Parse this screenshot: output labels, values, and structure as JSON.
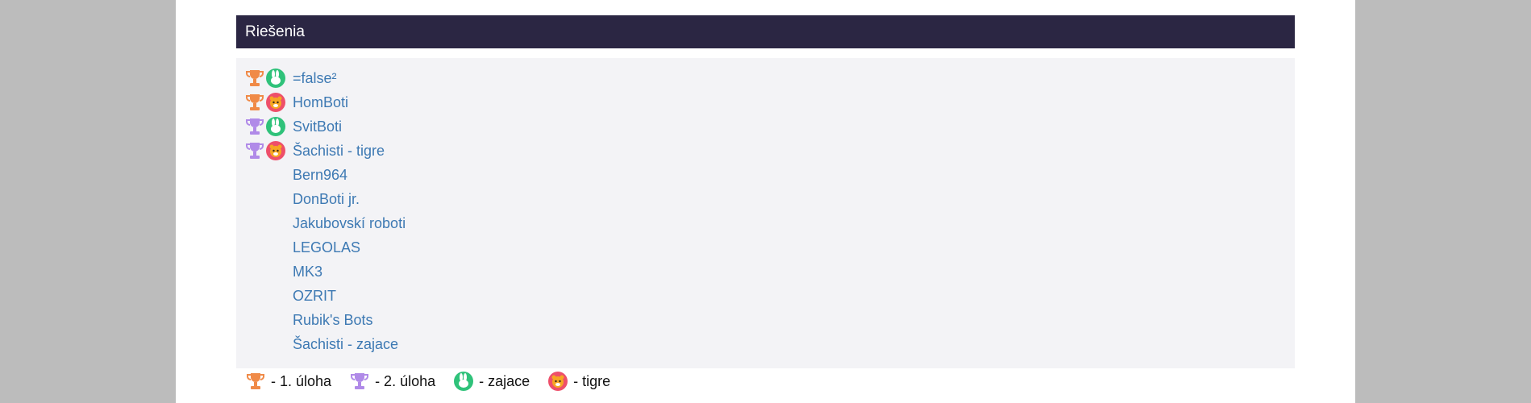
{
  "panel": {
    "title": "Riešenia"
  },
  "colors": {
    "header_bg": "#2b2643",
    "link": "#3d79b3",
    "trophy_first": "#f08a47",
    "trophy_second": "#b08ae8",
    "rabbit_badge": "#2fc27a",
    "tiger_badge": "#ee4f6a"
  },
  "teams": [
    {
      "name": "=false²",
      "trophy": "trophy-first-icon",
      "category": "rabbit-icon"
    },
    {
      "name": "HomBoti",
      "trophy": "trophy-first-icon",
      "category": "tiger-icon"
    },
    {
      "name": "SvitBoti",
      "trophy": "trophy-second-icon",
      "category": "rabbit-icon"
    },
    {
      "name": "Šachisti - tigre",
      "trophy": "trophy-second-icon",
      "category": "tiger-icon"
    },
    {
      "name": "Bern964"
    },
    {
      "name": "DonBoti jr."
    },
    {
      "name": "Jakubovskí roboti"
    },
    {
      "name": "LEGOLAS"
    },
    {
      "name": "MK3"
    },
    {
      "name": "OZRIT"
    },
    {
      "name": "Rubik's Bots"
    },
    {
      "name": "Šachisti - zajace"
    }
  ],
  "legend": {
    "first_task": "- 1. úloha",
    "second_task": "- 2. úloha",
    "rabbits": "- zajace",
    "tigers": "- tigre"
  }
}
